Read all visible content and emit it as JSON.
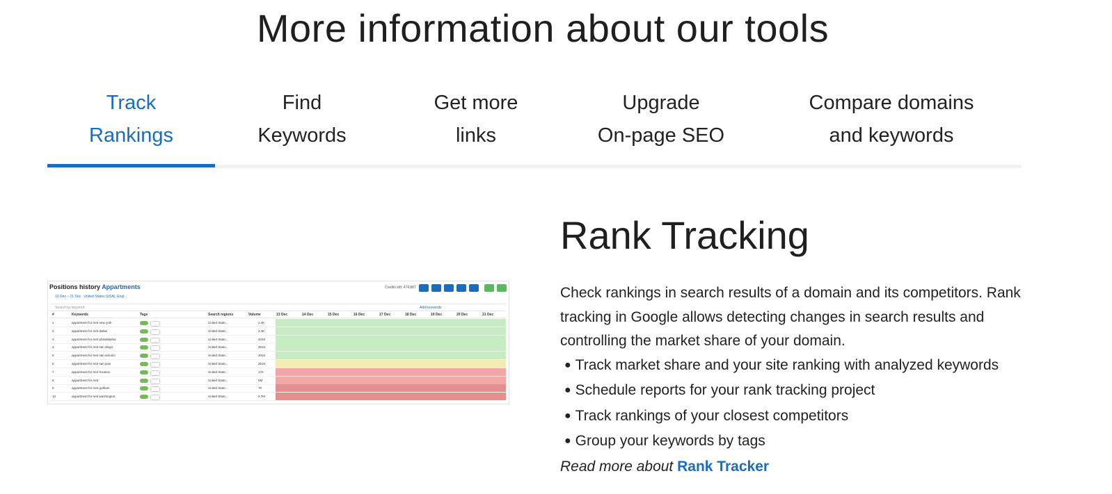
{
  "page": {
    "heading": "More information about our tools"
  },
  "tabs": [
    {
      "line1": "Track",
      "line2": "Rankings",
      "active": true
    },
    {
      "line1": "Find",
      "line2": "Keywords",
      "active": false
    },
    {
      "line1": "Get more",
      "line2": "links",
      "active": false
    },
    {
      "line1": "Upgrade",
      "line2": "On-page SEO",
      "active": false
    },
    {
      "line1": "Compare domains",
      "line2": "and keywords",
      "active": false
    }
  ],
  "content": {
    "title": "Rank Tracking",
    "paragraph": "Check rankings in search results of a domain and its competitors. Rank tracking in Google allows detecting changes in search results and controlling the market share of your domain.",
    "bullets": [
      "Track market share and your site ranking with analyzed keywords",
      "Schedule reports for your rank tracking project",
      "Track rankings of your closest competitors",
      "Group your keywords by tags"
    ],
    "read_more_prefix": "Read more about",
    "read_more_link": "Rank Tracker"
  },
  "screenshot": {
    "title": "Positions history",
    "project": "Appartments",
    "credits": "Credits left: 474,887",
    "date_range": "13 Dec – 21 Dec",
    "region": "United States (USA), Engl...",
    "search_placeholder": "Search by keyword",
    "add_keywords": "Add keywords",
    "columns": [
      "#",
      "Keywords",
      "Tags",
      "Search regions",
      "Volume",
      "13 Dec",
      "14 Dec",
      "15 Dec",
      "16 Dec",
      "17 Dec",
      "18 Dec",
      "19 Dec",
      "20 Dec",
      "21 Dec"
    ],
    "rows": [
      {
        "n": "1",
        "kw": "appartment for rent new york",
        "region": "United State...",
        "vol": "2.4K",
        "color": "gr"
      },
      {
        "n": "2",
        "kw": "appartment for rent dallas",
        "region": "United State...",
        "vol": "2.4K",
        "color": "gr"
      },
      {
        "n": "3",
        "kw": "appartment for rent philadelphia",
        "region": "United State...",
        "vol": "201K",
        "color": "gr"
      },
      {
        "n": "4",
        "kw": "appartment for rent san diego",
        "region": "United State...",
        "vol": "301K",
        "color": "gr"
      },
      {
        "n": "5",
        "kw": "appartment for rent san antonio",
        "region": "United State...",
        "vol": "301K",
        "color": "gr"
      },
      {
        "n": "6",
        "kw": "appartment for rent san jose",
        "region": "United State...",
        "vol": "301K",
        "color": "ye"
      },
      {
        "n": "7",
        "kw": "appartment for rent houston",
        "region": "United State...",
        "vol": "170",
        "color": "rd"
      },
      {
        "n": "8",
        "kw": "appartment for rent",
        "region": "United State...",
        "vol": "9M",
        "color": "rd"
      },
      {
        "n": "9",
        "kw": "appartment for rent gotham",
        "region": "United State...",
        "vol": "70",
        "color": "rd2"
      },
      {
        "n": "10",
        "kw": "appartment for rent washington",
        "region": "United State...",
        "vol": "2.7M",
        "color": "rd2"
      }
    ]
  },
  "colors": {
    "accent": "#1a6dbd",
    "tab_underline": "#f0f2f5"
  }
}
